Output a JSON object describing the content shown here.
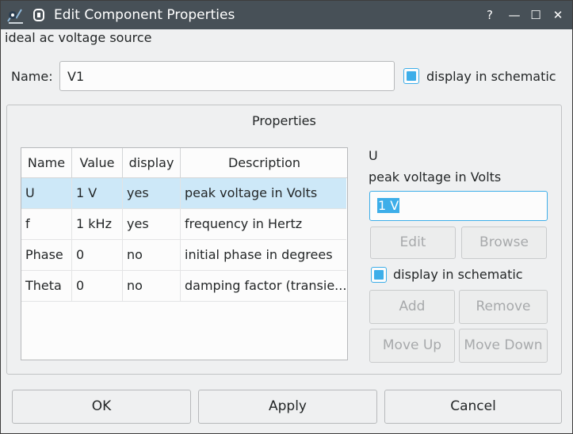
{
  "window": {
    "title": "Edit Component Properties",
    "help_glyph": "?",
    "minimize_glyph": "—",
    "maximize_glyph": "☐",
    "close_glyph": "✕"
  },
  "component": {
    "description": "ideal ac voltage source",
    "name_label": "Name:",
    "name_value": "V1",
    "display_label": "display in schematic",
    "display_checked": true
  },
  "properties": {
    "group_title": "Properties",
    "columns": [
      "Name",
      "Value",
      "display",
      "Description"
    ],
    "rows": [
      {
        "name": "U",
        "value": "1 V",
        "display": "yes",
        "description": "peak voltage in Volts",
        "selected": true
      },
      {
        "name": "f",
        "value": "1 kHz",
        "display": "yes",
        "description": "frequency in Hertz",
        "selected": false
      },
      {
        "name": "Phase",
        "value": "0",
        "display": "no",
        "description": "initial phase in degrees",
        "selected": false
      },
      {
        "name": "Theta",
        "value": "0",
        "display": "no",
        "description": "damping factor (transie...",
        "selected": false
      }
    ]
  },
  "editor": {
    "prop_name": "U",
    "prop_desc": "peak voltage in Volts",
    "value": "1 V",
    "edit_label": "Edit",
    "browse_label": "Browse",
    "display_label": "display in schematic",
    "display_checked": true,
    "add_label": "Add",
    "remove_label": "Remove",
    "move_up_label": "Move Up",
    "move_down_label": "Move Down"
  },
  "footer": {
    "ok_label": "OK",
    "apply_label": "Apply",
    "cancel_label": "Cancel"
  },
  "colors": {
    "accent": "#3daee9",
    "selection": "#cde8f8",
    "titlebar": "#475057"
  }
}
